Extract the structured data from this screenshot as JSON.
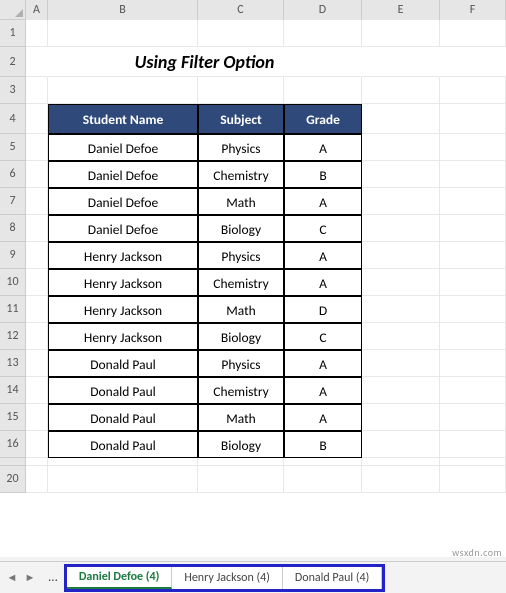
{
  "columns": [
    "A",
    "B",
    "C",
    "D",
    "E",
    "F"
  ],
  "title": "Using Filter Option",
  "table": {
    "headers": [
      "Student Name",
      "Subject",
      "Grade"
    ],
    "rows": [
      [
        "Daniel Defoe",
        "Physics",
        "A"
      ],
      [
        "Daniel Defoe",
        "Chemistry",
        "B"
      ],
      [
        "Daniel Defoe",
        "Math",
        "A"
      ],
      [
        "Daniel Defoe",
        "Biology",
        "C"
      ],
      [
        "Henry Jackson",
        "Physics",
        "A"
      ],
      [
        "Henry Jackson",
        "Chemistry",
        "A"
      ],
      [
        "Henry Jackson",
        "Math",
        "D"
      ],
      [
        "Henry Jackson",
        "Biology",
        "C"
      ],
      [
        "Donald Paul",
        "Physics",
        "A"
      ],
      [
        "Donald Paul",
        "Chemistry",
        "A"
      ],
      [
        "Donald Paul",
        "Math",
        "A"
      ],
      [
        "Donald Paul",
        "Biology",
        "B"
      ]
    ]
  },
  "row_numbers": [
    "1",
    "2",
    "3",
    "4",
    "5",
    "6",
    "7",
    "8",
    "9",
    "10",
    "11",
    "12",
    "13",
    "14",
    "15",
    "16",
    "",
    "20"
  ],
  "nav": {
    "dots": "...",
    "prev": "◄",
    "next": "►"
  },
  "tabs": [
    {
      "label": "Daniel Defoe (4)",
      "active": true
    },
    {
      "label": "Henry Jackson (4)",
      "active": false
    },
    {
      "label": "Donald Paul (4)",
      "active": false
    }
  ],
  "watermark": "wsxdn.com"
}
